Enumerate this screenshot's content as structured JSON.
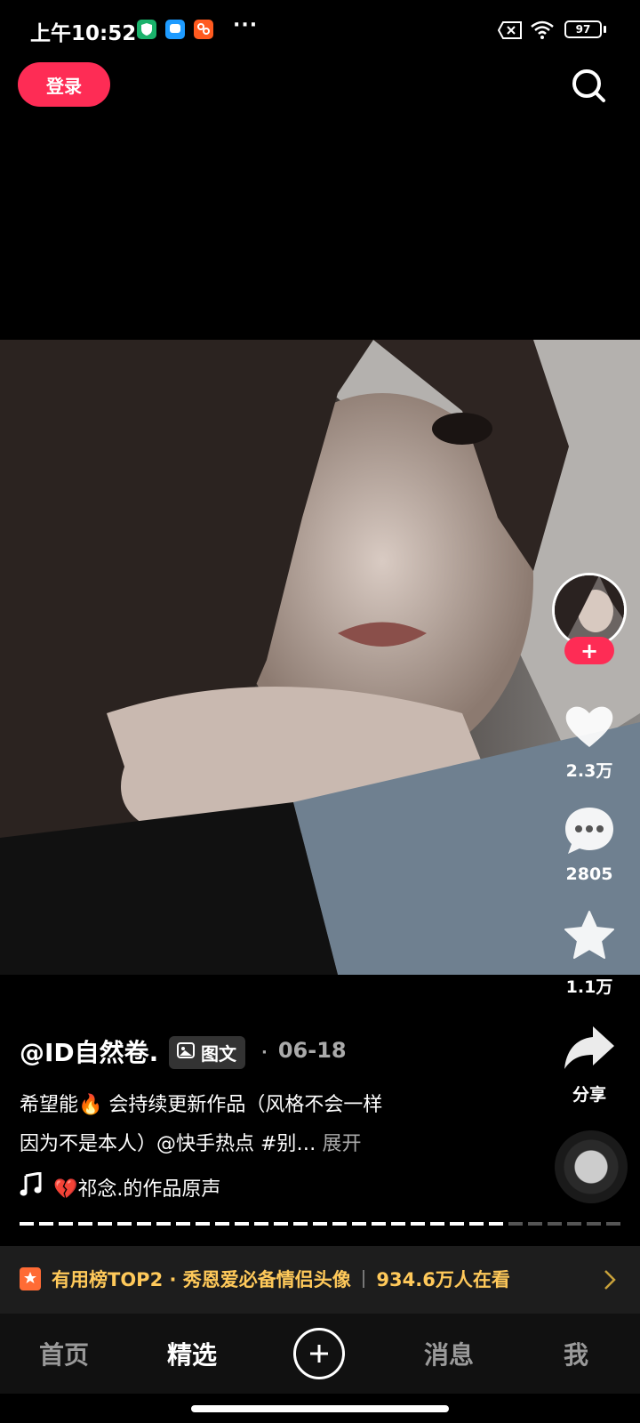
{
  "status_bar": {
    "time": "上午10:52",
    "more": "···",
    "battery": "97",
    "icons": [
      "security-app-icon",
      "chat-app-icon",
      "orange-app-icon",
      "sim-icon",
      "wifi-icon",
      "battery-icon"
    ]
  },
  "top_bar": {
    "login_label": "登录",
    "search_icon": "search-icon"
  },
  "side_rail": {
    "follow_label": "+",
    "like_count": "2.3万",
    "comment_count": "2805",
    "favorite_count": "1.1万",
    "share_label": "分享"
  },
  "post": {
    "author": "@ID自然卷.",
    "type_tag": "图文",
    "date_separator": "·",
    "date": "06-18",
    "caption_line1": "希望能🔥 会持续更新作品（风格不会一样",
    "caption_line2": "因为不是本人）@快手热点 #别…",
    "expand_label": "展开",
    "music": "💔祁念.的作品原声",
    "progress": {
      "total_segments": 31,
      "current_segment": 25
    }
  },
  "rank_banner": {
    "text": "有用榜TOP2 · 秀恩爱必备情侣头像",
    "viewers": "934.6万人在看"
  },
  "bottom_nav": {
    "items": [
      {
        "label": "首页",
        "active": false
      },
      {
        "label": "精选",
        "active": true
      },
      {
        "label": "+",
        "active": false
      },
      {
        "label": "消息",
        "active": false
      },
      {
        "label": "我",
        "active": false
      }
    ]
  },
  "colors": {
    "accent": "#fe2c55",
    "rank_text": "#ffc95a",
    "background": "#000000"
  }
}
